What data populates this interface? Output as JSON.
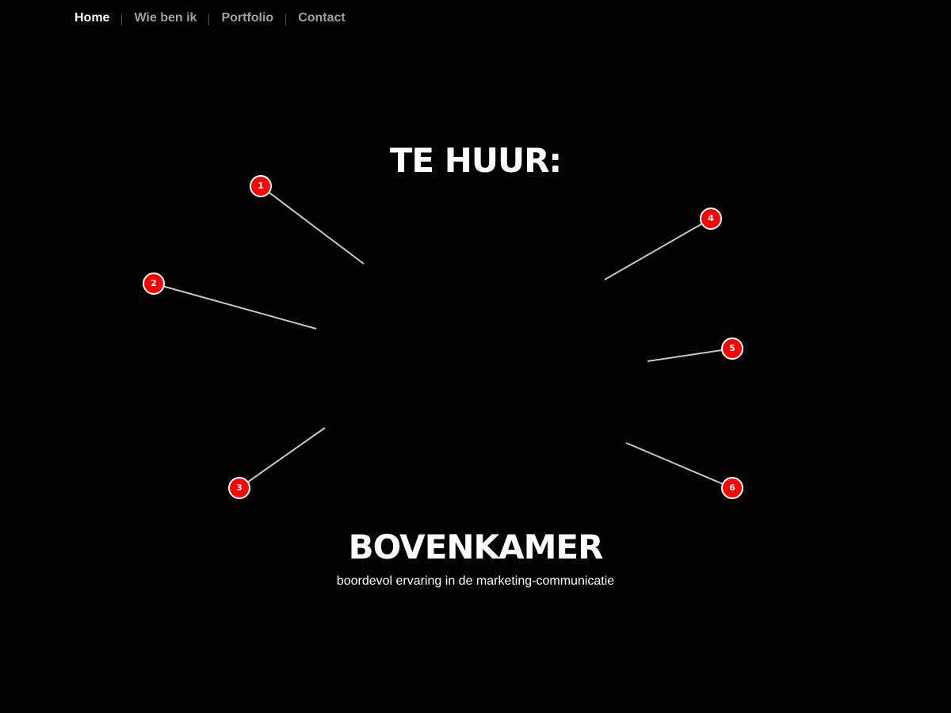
{
  "nav": {
    "items": [
      {
        "label": "Home",
        "active": true
      },
      {
        "label": "Wie ben ik",
        "active": false
      },
      {
        "label": "Portfolio",
        "active": false
      },
      {
        "label": "Contact",
        "active": false
      }
    ]
  },
  "hero": {
    "heading": "TE HUUR:",
    "name": "BOVENKAMER",
    "tagline": "boordevol ervaring in de marketing-communicatie"
  },
  "hotspots": [
    {
      "label": "1"
    },
    {
      "label": "2"
    },
    {
      "label": "3"
    },
    {
      "label": "4"
    },
    {
      "label": "5"
    },
    {
      "label": "6"
    }
  ],
  "colors": {
    "background": "#000000",
    "hotspot": "#ff0000",
    "line": "#c8c8c8",
    "nav_inactive": "#a0a0a0",
    "nav_active": "#ffffff"
  }
}
